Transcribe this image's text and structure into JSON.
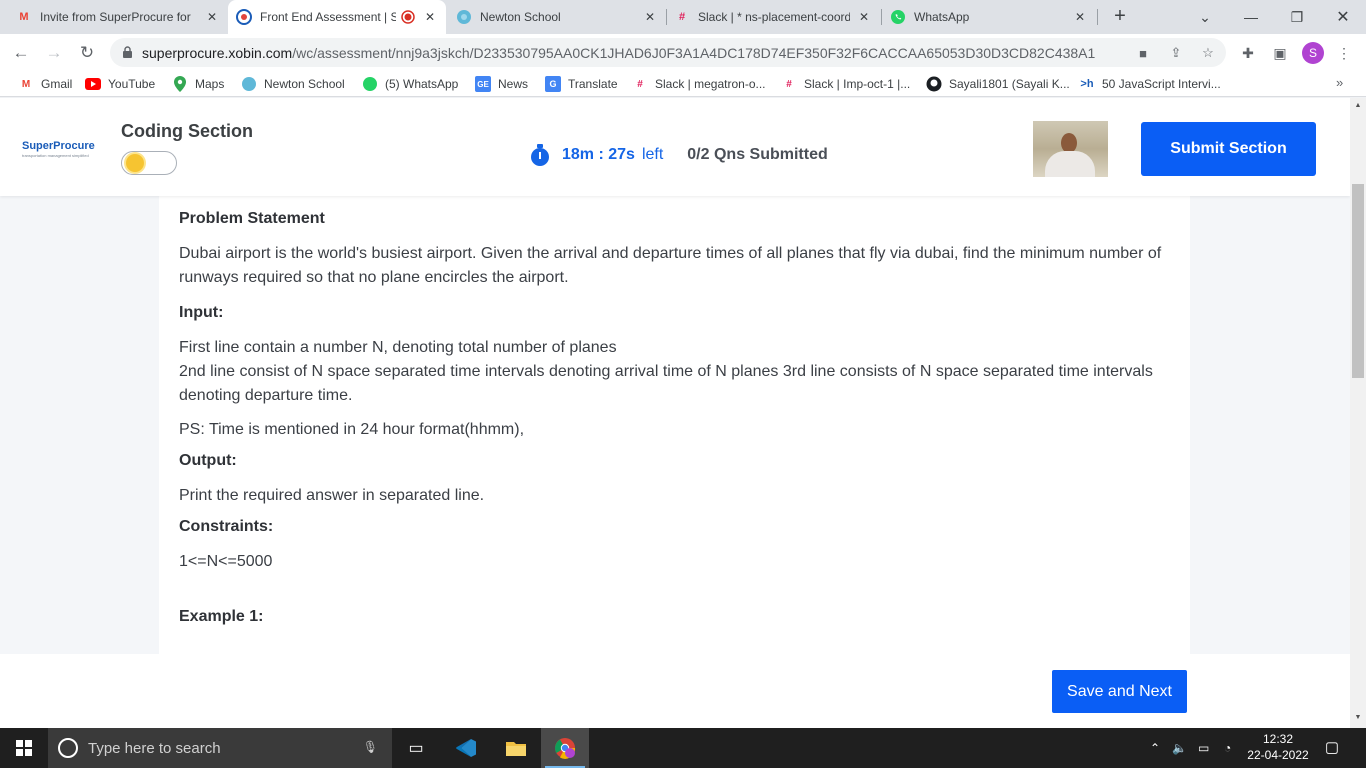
{
  "browser": {
    "tabs": [
      {
        "title": "Invite from SuperProcure for",
        "icon": "gmail-icon"
      },
      {
        "title": "Front End Assessment | S",
        "icon": "xobin-icon"
      },
      {
        "title": "Newton School",
        "icon": "newton-icon"
      },
      {
        "title": "Slack | * ns-placement-coord",
        "icon": "slack-icon"
      },
      {
        "title": "WhatsApp",
        "icon": "whatsapp-icon"
      }
    ],
    "url_host": "superprocure.xobin.com",
    "url_path": "/wc/assessment/nnj9a3jskch/D233530795AA0CK1JHAD6J0F3A1A4DC178D74EF350F32F6CACCAA65053D30D3CD82C438A1",
    "profile_initial": "S"
  },
  "bookmarks": [
    {
      "label": "Gmail"
    },
    {
      "label": "YouTube"
    },
    {
      "label": "Maps"
    },
    {
      "label": "Newton School"
    },
    {
      "label": "(5) WhatsApp"
    },
    {
      "label": "News"
    },
    {
      "label": "Translate"
    },
    {
      "label": "Slack | megatron-o..."
    },
    {
      "label": "Slack | Imp-oct-1 |..."
    },
    {
      "label": "Sayali1801 (Sayali K..."
    },
    {
      "label": "50 JavaScript Intervi..."
    }
  ],
  "header": {
    "logo_text": "SuperProcure",
    "logo_tagline": "transportation management simplified",
    "section_title": "Coding Section",
    "timer_value": "18m : 27s",
    "timer_suffix": "left",
    "qns_submitted": "0/2 Qns Submitted",
    "submit_label": "Submit Section"
  },
  "problem": {
    "heading": "Problem Statement",
    "statement": "Dubai airport is the world's busiest airport. Given the arrival and departure times of all planes that fly via dubai, find the minimum number of runways required so that no plane encircles the airport.",
    "input_heading": "Input:",
    "input_line1": "First line contain a number N, denoting total number of planes",
    "input_line2": "2nd line consist of N space separated time intervals denoting arrival time of N planes 3rd line consists of N space separated time intervals denoting departure time.",
    "ps": "PS: Time is mentioned in 24 hour format(hhmm),",
    "output_heading": "Output:",
    "output_text": "Print the required answer in separated line.",
    "constraints_heading": "Constraints:",
    "constraints_text": "1<=N<=5000",
    "example_heading": "Example 1:"
  },
  "footer": {
    "save_next_label": "Save and Next"
  },
  "taskbar": {
    "search_placeholder": "Type here to search",
    "time": "12:32",
    "date": "22-04-2022"
  },
  "colors": {
    "primary_blue": "#0a5ef5",
    "timer_blue": "#1565e6"
  }
}
